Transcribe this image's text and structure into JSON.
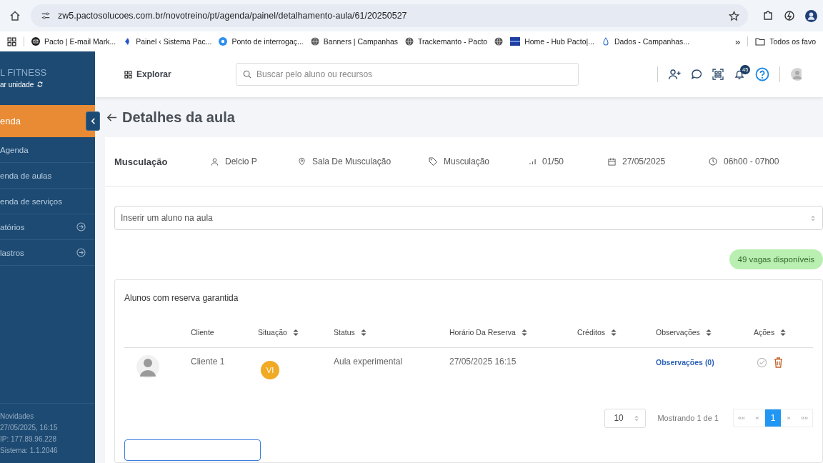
{
  "browser": {
    "url": "zw5.pactosolucoes.com.br/novotreino/pt/agenda/painel/detalhamento-aula/61/20250527",
    "bookmarks": [
      {
        "kind": "mail",
        "label": "Pacto | E-mail Mark..."
      },
      {
        "kind": "arrow",
        "label": "Painel ‹ Sistema Pac..."
      },
      {
        "kind": "circle",
        "label": "Ponto de interrogaç..."
      },
      {
        "kind": "globe",
        "label": "Banners | Campanhas"
      },
      {
        "kind": "globe",
        "label": "Trackemanto - Pacto"
      },
      {
        "kind": "globe"
      },
      {
        "kind": "square",
        "label": "Home - Hub Pacto|..."
      },
      {
        "kind": "drop",
        "label": "Dados - Campanhas..."
      }
    ],
    "more": "»",
    "all_bookmarks": "Todos os favo"
  },
  "sidebar": {
    "brand": "L FITNESS",
    "switch_unit": "ar unidade",
    "items": [
      {
        "label": "enda",
        "selected": true,
        "expandable": false
      },
      {
        "label": "Agenda",
        "selected": false,
        "expandable": false
      },
      {
        "label": "enda de aulas",
        "selected": false,
        "expandable": false
      },
      {
        "label": "enda de serviços",
        "selected": false,
        "expandable": false
      },
      {
        "label": "atórios",
        "selected": false,
        "expandable": true
      },
      {
        "label": "lastros",
        "selected": false,
        "expandable": true
      }
    ],
    "footer": [
      "Novidades",
      "27/05/2025, 16:15",
      "IP: 177.89.96.228",
      "Sistema: 1.1.2046"
    ]
  },
  "topbar": {
    "explore": "Explorar",
    "search_placeholder": "Buscar pelo aluno ou recursos",
    "notifications": "45"
  },
  "page": {
    "title": "Detalhes da aula"
  },
  "class_info": {
    "name": "Musculação",
    "details": [
      {
        "kind": "person",
        "text": "Delcio P"
      },
      {
        "kind": "location",
        "text": "Sala De Musculação"
      },
      {
        "kind": "tag",
        "text": "Musculação"
      },
      {
        "kind": "capacity",
        "text": "01/50"
      },
      {
        "kind": "date",
        "text": "27/05/2025"
      },
      {
        "kind": "time",
        "text": "06h00 - 07h00"
      }
    ]
  },
  "insert_field": {
    "placeholder": "Inserir um aluno na aula"
  },
  "vacancies": "49 vagas disponíveis",
  "reservations": {
    "title": "Alunos com reserva garantida",
    "columns": [
      {
        "label": "Cliente",
        "sortable": false
      },
      {
        "label": "Situação",
        "sortable": true
      },
      {
        "label": "Status",
        "sortable": true
      },
      {
        "label": "Horário Da Reserva",
        "sortable": true
      },
      {
        "label": "Créditos",
        "sortable": true
      },
      {
        "label": "Observações",
        "sortable": true
      },
      {
        "label": "Ações",
        "sortable": true
      }
    ],
    "rows": [
      {
        "client": "Cliente 1",
        "situation": "VI",
        "status": "Aula experimental",
        "time": "27/05/2025 16:15",
        "notes": "Observações (0)"
      }
    ]
  },
  "pagination": {
    "page_size": "10",
    "summary": "Mostrando 1 de 1",
    "pages": [
      {
        "label": "««",
        "selected": false
      },
      {
        "label": "«",
        "selected": false
      },
      {
        "label": "1",
        "selected": true
      },
      {
        "label": "»",
        "selected": false
      },
      {
        "label": "»»",
        "selected": false
      }
    ]
  }
}
